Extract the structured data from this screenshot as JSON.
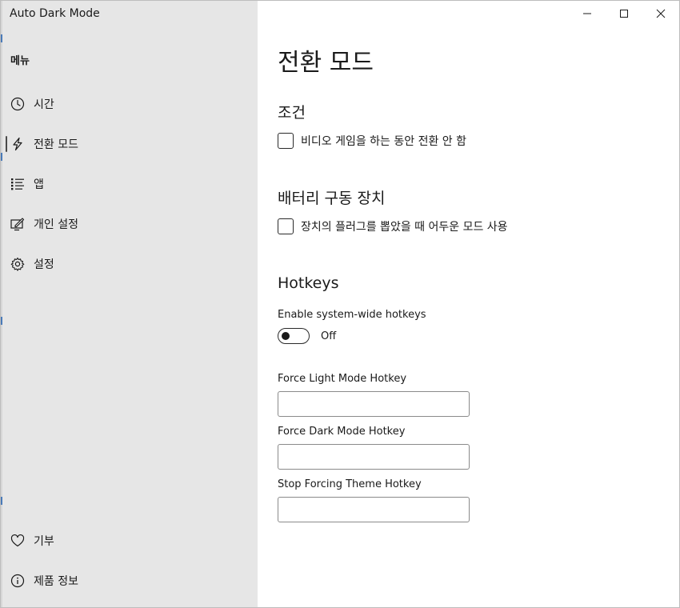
{
  "window": {
    "title": "Auto Dark Mode"
  },
  "sidebar": {
    "menu_label": "메뉴",
    "items": [
      {
        "label": "시간",
        "icon": "clock-icon"
      },
      {
        "label": "전환 모드",
        "icon": "lightning-icon",
        "selected": true
      },
      {
        "label": "앱",
        "icon": "list-icon"
      },
      {
        "label": "개인 설정",
        "icon": "personalize-icon"
      },
      {
        "label": "설정",
        "icon": "gear-icon"
      }
    ],
    "footer_items": [
      {
        "label": "기부",
        "icon": "heart-icon"
      },
      {
        "label": "제품 정보",
        "icon": "info-icon"
      }
    ]
  },
  "main": {
    "page_title": "전환 모드",
    "conditions": {
      "title": "조건",
      "checkbox_label": "비디오 게임을 하는 동안 전환 안 함",
      "checked": false
    },
    "battery": {
      "title": "배터리 구동 장치",
      "checkbox_label": "장치의 플러그를 뽑았을 때 어두운 모드 사용",
      "checked": false
    },
    "hotkeys": {
      "title": "Hotkeys",
      "enable_label": "Enable system-wide hotkeys",
      "toggle_state": "Off",
      "toggle_on": false,
      "force_light_label": "Force Light Mode Hotkey",
      "force_light_value": "",
      "force_dark_label": "Force Dark Mode Hotkey",
      "force_dark_value": "",
      "stop_forcing_label": "Stop Forcing Theme Hotkey",
      "stop_forcing_value": ""
    }
  },
  "colors": {
    "sidebar_bg": "#e6e6e6",
    "content_bg": "#ffffff",
    "text": "#1a1a1a",
    "accent_edge": "#4a7ab8"
  }
}
